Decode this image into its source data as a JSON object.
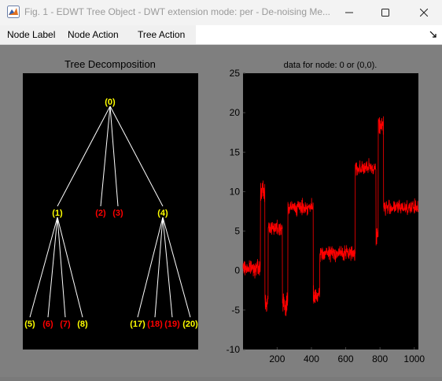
{
  "window": {
    "title": "Fig. 1 - EDWT Tree Object - DWT extension mode: per  -  De-noising Me...",
    "app_icon": "matlab-figure-icon",
    "controls": [
      "minimize-icon",
      "maximize-icon",
      "close-icon"
    ]
  },
  "menubar": {
    "items": [
      "Node Label",
      "Node Action",
      "Tree Action"
    ],
    "dock_icon": "dock-arrow-icon"
  },
  "tree_panel": {
    "title": "Tree Decomposition",
    "colors": {
      "background": "#000000",
      "edge": "#ffffff",
      "node_yellow": "#ffff00",
      "node_red": "#ff0000"
    },
    "nodes": [
      {
        "id": "0",
        "label": "(0)",
        "color": "yellow",
        "parent": null
      },
      {
        "id": "1",
        "label": "(1)",
        "color": "yellow",
        "parent": "0"
      },
      {
        "id": "2",
        "label": "(2)",
        "color": "red",
        "parent": "0"
      },
      {
        "id": "3",
        "label": "(3)",
        "color": "red",
        "parent": "0"
      },
      {
        "id": "4",
        "label": "(4)",
        "color": "yellow",
        "parent": "0"
      },
      {
        "id": "5",
        "label": "(5)",
        "color": "yellow",
        "parent": "1"
      },
      {
        "id": "6",
        "label": "(6)",
        "color": "red",
        "parent": "1"
      },
      {
        "id": "7",
        "label": "(7)",
        "color": "red",
        "parent": "1"
      },
      {
        "id": "8",
        "label": "(8)",
        "color": "yellow",
        "parent": "1"
      },
      {
        "id": "17",
        "label": "(17)",
        "color": "yellow",
        "parent": "4"
      },
      {
        "id": "18",
        "label": "(18)",
        "color": "red",
        "parent": "4"
      },
      {
        "id": "19",
        "label": "(19)",
        "color": "red",
        "parent": "4"
      },
      {
        "id": "20",
        "label": "(20)",
        "color": "yellow",
        "parent": "4"
      }
    ]
  },
  "chart_data": {
    "type": "line",
    "title": "data for node: 0 or (0,0).",
    "xlabel": "",
    "ylabel": "",
    "xlim": [
      1,
      1024
    ],
    "ylim": [
      -10,
      25
    ],
    "xticks": [
      200,
      400,
      600,
      800,
      1000
    ],
    "yticks": [
      -10,
      -5,
      0,
      5,
      10,
      15,
      20,
      25
    ],
    "grid": false,
    "background": "#000000",
    "line_color": "#ff0000",
    "series": [
      {
        "segments": [
          {
            "x_start": 1,
            "x_end": 102,
            "level": 0.3,
            "noise": 0.8
          },
          {
            "x_start": 103,
            "x_end": 128,
            "level": 10,
            "noise": 1.2
          },
          {
            "x_start": 129,
            "x_end": 147,
            "level": -4,
            "noise": 1.0
          },
          {
            "x_start": 148,
            "x_end": 230,
            "level": 5.5,
            "noise": 0.8
          },
          {
            "x_start": 231,
            "x_end": 262,
            "level": -4.3,
            "noise": 1.2
          },
          {
            "x_start": 263,
            "x_end": 410,
            "level": 8,
            "noise": 0.8
          },
          {
            "x_start": 411,
            "x_end": 448,
            "level": -3.3,
            "noise": 0.9
          },
          {
            "x_start": 449,
            "x_end": 655,
            "level": 2.2,
            "noise": 0.8
          },
          {
            "x_start": 656,
            "x_end": 776,
            "level": 13,
            "noise": 0.8
          },
          {
            "x_start": 777,
            "x_end": 789,
            "level": 4.5,
            "noise": 1.0
          },
          {
            "x_start": 790,
            "x_end": 820,
            "level": 18.5,
            "noise": 1.2
          },
          {
            "x_start": 821,
            "x_end": 1024,
            "level": 8,
            "noise": 0.8
          }
        ]
      }
    ]
  }
}
